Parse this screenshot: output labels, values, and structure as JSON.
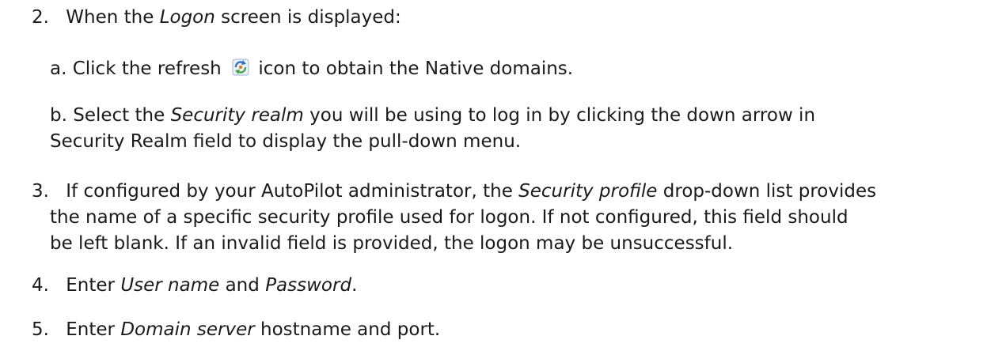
{
  "steps": [
    {
      "num": "2.",
      "text_pre": "When the ",
      "em": "Logon",
      "text_post": " screen is displayed:",
      "substeps": [
        {
          "label": "a.",
          "text_pre": "Click the refresh ",
          "icon": "refresh-icon",
          "text_post": " icon to obtain the Native domains."
        },
        {
          "label": "b.",
          "text_pre": "Select the ",
          "em": "Security realm",
          "text_post_line1": " you will be using to log in by clicking the down arrow in",
          "text_line2": "Security Realm  field to display the pull-down menu."
        }
      ]
    },
    {
      "num": "3.",
      "line1_pre": "If configured by your AutoPilot administrator, the ",
      "line1_em": "Security profile",
      "line1_post": " drop-down list provides",
      "line2": "the name of a specific security profile used for logon.  If not configured, this field should",
      "line3": "be left blank.  If an invalid field is provided, the logon may be unsuccessful."
    },
    {
      "num": "4.",
      "text_pre": "Enter ",
      "em1": "User name",
      "mid": " and ",
      "em2": "Password",
      "text_post": "."
    },
    {
      "num": "5.",
      "text_pre": "Enter ",
      "em": "Domain server",
      "text_post": " hostname and port."
    }
  ],
  "icon_colors": {
    "refresh_blue": "#2a6fc9",
    "refresh_green": "#3aa845",
    "refresh_orange": "#e07a1f"
  }
}
